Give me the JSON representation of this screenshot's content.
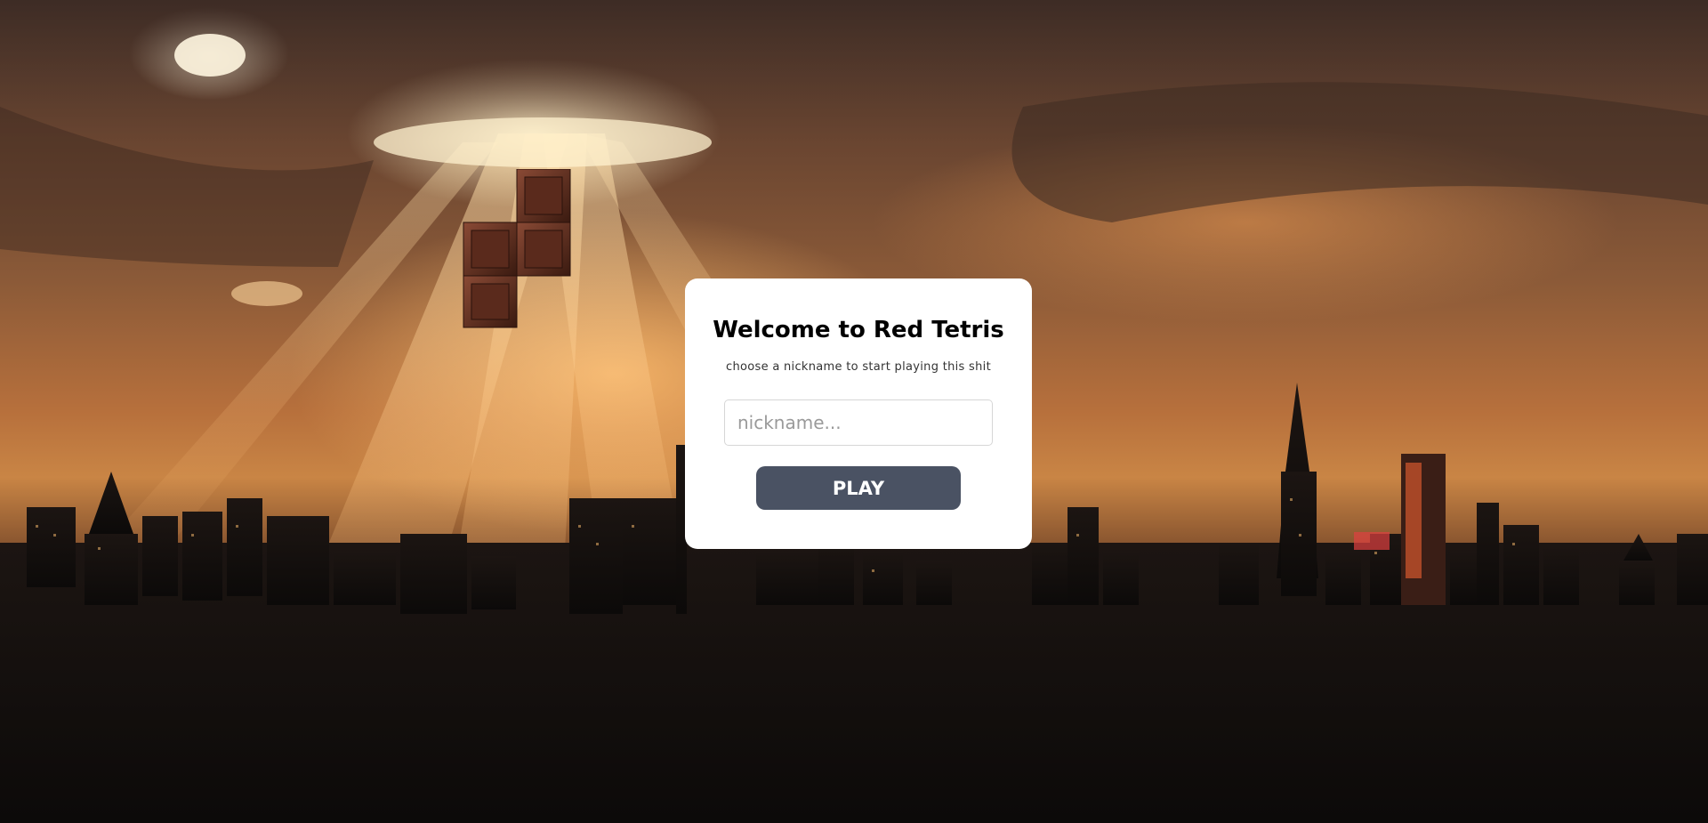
{
  "login": {
    "title": "Welcome to Red Tetris",
    "subtitle": "choose a nickname to start playing this shit",
    "nickname_placeholder": "nickname...",
    "nickname_value": "",
    "play_label": "PLAY"
  },
  "colors": {
    "panel_background": "#ffffff",
    "play_button": "#4a5263",
    "tetromino": "#5a2a1c"
  }
}
